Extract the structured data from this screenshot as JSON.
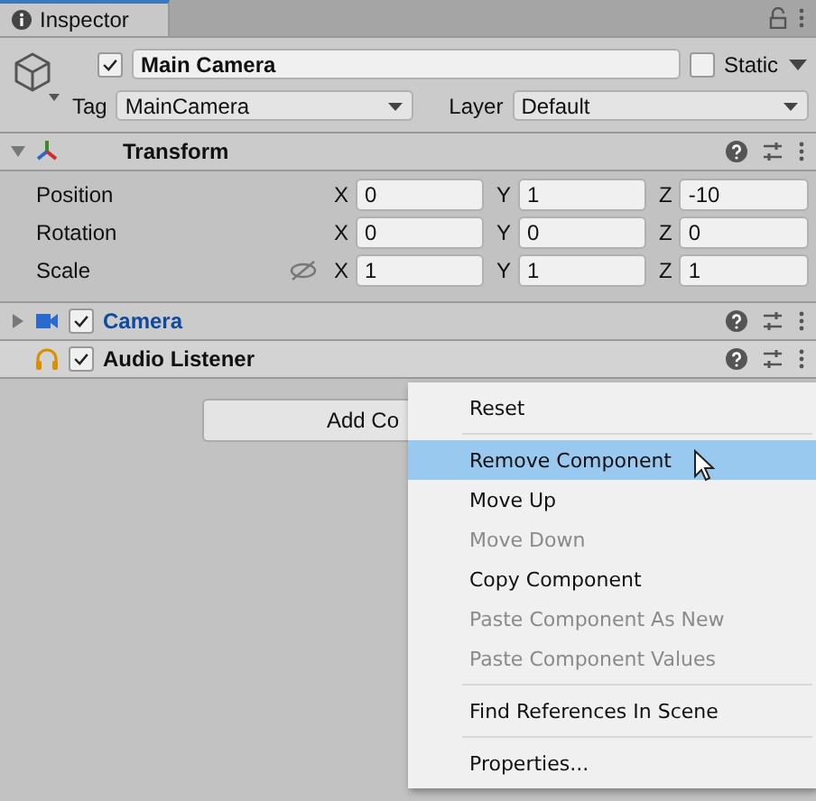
{
  "tab": {
    "label": "Inspector",
    "selected": true
  },
  "object": {
    "active": true,
    "name": "Main Camera",
    "static": false,
    "static_label": "Static",
    "tag_label": "Tag",
    "tag": "MainCamera",
    "layer_label": "Layer",
    "layer": "Default"
  },
  "components": [
    {
      "kind": "transform",
      "name": "Transform",
      "expanded": true,
      "color": "#101010"
    },
    {
      "kind": "camera",
      "name": "Camera",
      "expanded": false,
      "enabled": true,
      "color": "#0d4aa0"
    },
    {
      "kind": "audio",
      "name": "Audio Listener",
      "enabled": true,
      "color": "#101010"
    }
  ],
  "transform_rows": [
    {
      "label": "Position",
      "axes": [
        {
          "axis": "X",
          "value": "0"
        },
        {
          "axis": "Y",
          "value": "1"
        },
        {
          "axis": "Z",
          "value": "-10"
        }
      ]
    },
    {
      "label": "Rotation",
      "axes": [
        {
          "axis": "X",
          "value": "0"
        },
        {
          "axis": "Y",
          "value": "0"
        },
        {
          "axis": "Z",
          "value": "0"
        }
      ]
    },
    {
      "label": "Scale",
      "linked": true,
      "axes": [
        {
          "axis": "X",
          "value": "1"
        },
        {
          "axis": "Y",
          "value": "1"
        },
        {
          "axis": "Z",
          "value": "1"
        }
      ]
    }
  ],
  "add_button": {
    "label": "Add Co"
  },
  "context_menu": [
    {
      "kind": "item",
      "label": "Reset",
      "disabled": false,
      "selected": false
    },
    {
      "kind": "separator"
    },
    {
      "kind": "item",
      "label": "Remove Component",
      "disabled": false,
      "selected": true
    },
    {
      "kind": "item",
      "label": "Move Up",
      "disabled": false,
      "selected": false
    },
    {
      "kind": "item",
      "label": "Move Down",
      "disabled": true,
      "selected": false
    },
    {
      "kind": "item",
      "label": "Copy Component",
      "disabled": false,
      "selected": false
    },
    {
      "kind": "item",
      "label": "Paste Component As New",
      "disabled": true,
      "selected": false
    },
    {
      "kind": "item",
      "label": "Paste Component Values",
      "disabled": true,
      "selected": false
    },
    {
      "kind": "separator"
    },
    {
      "kind": "item",
      "label": "Find References In Scene",
      "disabled": false,
      "selected": false
    },
    {
      "kind": "separator"
    },
    {
      "kind": "item",
      "label": "Properties...",
      "disabled": false,
      "selected": false
    }
  ]
}
